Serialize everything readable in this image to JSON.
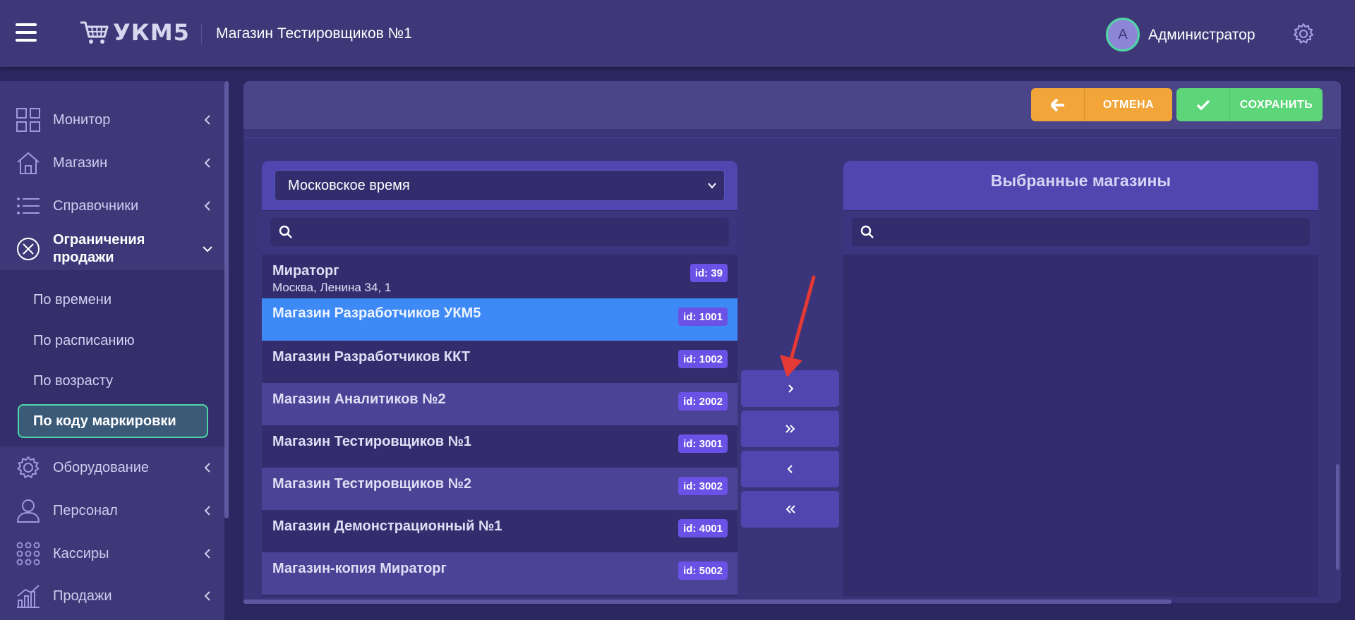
{
  "header": {
    "logo_text": "УКМ5",
    "store_title": "Магазин Тестировщиков №1",
    "avatar_letter": "А",
    "user_name": "Администратор"
  },
  "sidebar": {
    "items": [
      {
        "label": "Монитор",
        "icon": "dashboard-icon"
      },
      {
        "label": "Магазин",
        "icon": "home-icon"
      },
      {
        "label": "Справочники",
        "icon": "list-icon"
      },
      {
        "label": "Ограничения продажи",
        "line1": "Ограничения",
        "line2": "продажи",
        "icon": "cancel-circle-icon"
      },
      {
        "label": "Оборудование",
        "icon": "gear-icon"
      },
      {
        "label": "Персонал",
        "icon": "user-icon"
      },
      {
        "label": "Кассиры",
        "icon": "grid-dots-icon"
      },
      {
        "label": "Продажи",
        "icon": "chart-icon"
      }
    ],
    "submenu": [
      {
        "label": "По времени"
      },
      {
        "label": "По расписанию"
      },
      {
        "label": "По возрасту"
      },
      {
        "label": "По коду маркировки",
        "active": true
      }
    ]
  },
  "toolbar": {
    "cancel_label": "ОТМЕНА",
    "save_label": "СОХРАНИТЬ"
  },
  "left_panel": {
    "timezone": "Московское время",
    "search_placeholder": "",
    "stores": [
      {
        "name": "Мираторг",
        "address": "Москва, Ленина 34, 1",
        "id": "id: 39"
      },
      {
        "name": "Магазин Разработчиков УКМ5",
        "id": "id: 1001",
        "selected": true
      },
      {
        "name": "Магазин Разработчиков ККТ",
        "id": "id: 1002"
      },
      {
        "name": "Магазин Аналитиков №2",
        "id": "id: 2002"
      },
      {
        "name": "Магазин Тестировщиков №1",
        "id": "id: 3001"
      },
      {
        "name": "Магазин Тестировщиков №2",
        "id": "id: 3002"
      },
      {
        "name": "Магазин Демонстрационный №1",
        "id": "id: 4001"
      },
      {
        "name": "Магазин-копия Мираторг",
        "id": "id: 5002"
      }
    ]
  },
  "right_panel": {
    "title": "Выбранные магазины",
    "search_placeholder": ""
  },
  "colors": {
    "accent": "#4f46b0",
    "selected_row": "#3d8af7",
    "cancel": "#f2a63a",
    "save": "#5dd679",
    "badge": "#6a52e6",
    "annotation": "#e53935"
  }
}
